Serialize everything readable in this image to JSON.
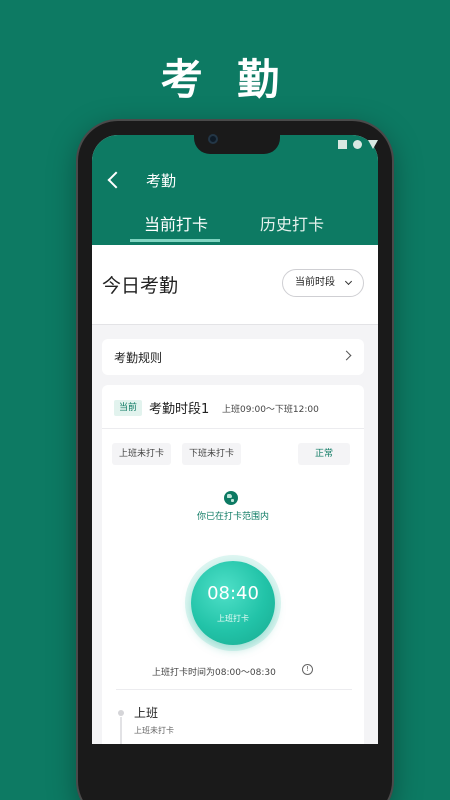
{
  "promo": {
    "title": "考 勤"
  },
  "header": {
    "title": "考勤"
  },
  "tabs": [
    {
      "label": "当前打卡"
    },
    {
      "label": "历史打卡"
    }
  ],
  "today": {
    "title": "今日考勤",
    "period_selector": "当前时段"
  },
  "rules": {
    "label": "考勤规则"
  },
  "period": {
    "badge": "当前",
    "name": "考勤时段1",
    "time": "上班09:00～下班12:00"
  },
  "status_chips": {
    "clock_in": "上班未打卡",
    "clock_out": "下班未打卡",
    "status": "正常"
  },
  "location": {
    "text": "你已在打卡范围内"
  },
  "punch": {
    "time": "08:40",
    "label": "上班打卡"
  },
  "window": {
    "text": "上班打卡时间为08:00～08:30",
    "info_glyph": "!"
  },
  "record": {
    "title": "上班",
    "subtitle": "上班未打卡"
  },
  "colors": {
    "brand": "#0d7a63",
    "accent": "#22c3a8"
  },
  "icons": [
    "back-icon",
    "chevron-down-icon",
    "chevron-right-icon",
    "globe-icon",
    "info-icon"
  ]
}
